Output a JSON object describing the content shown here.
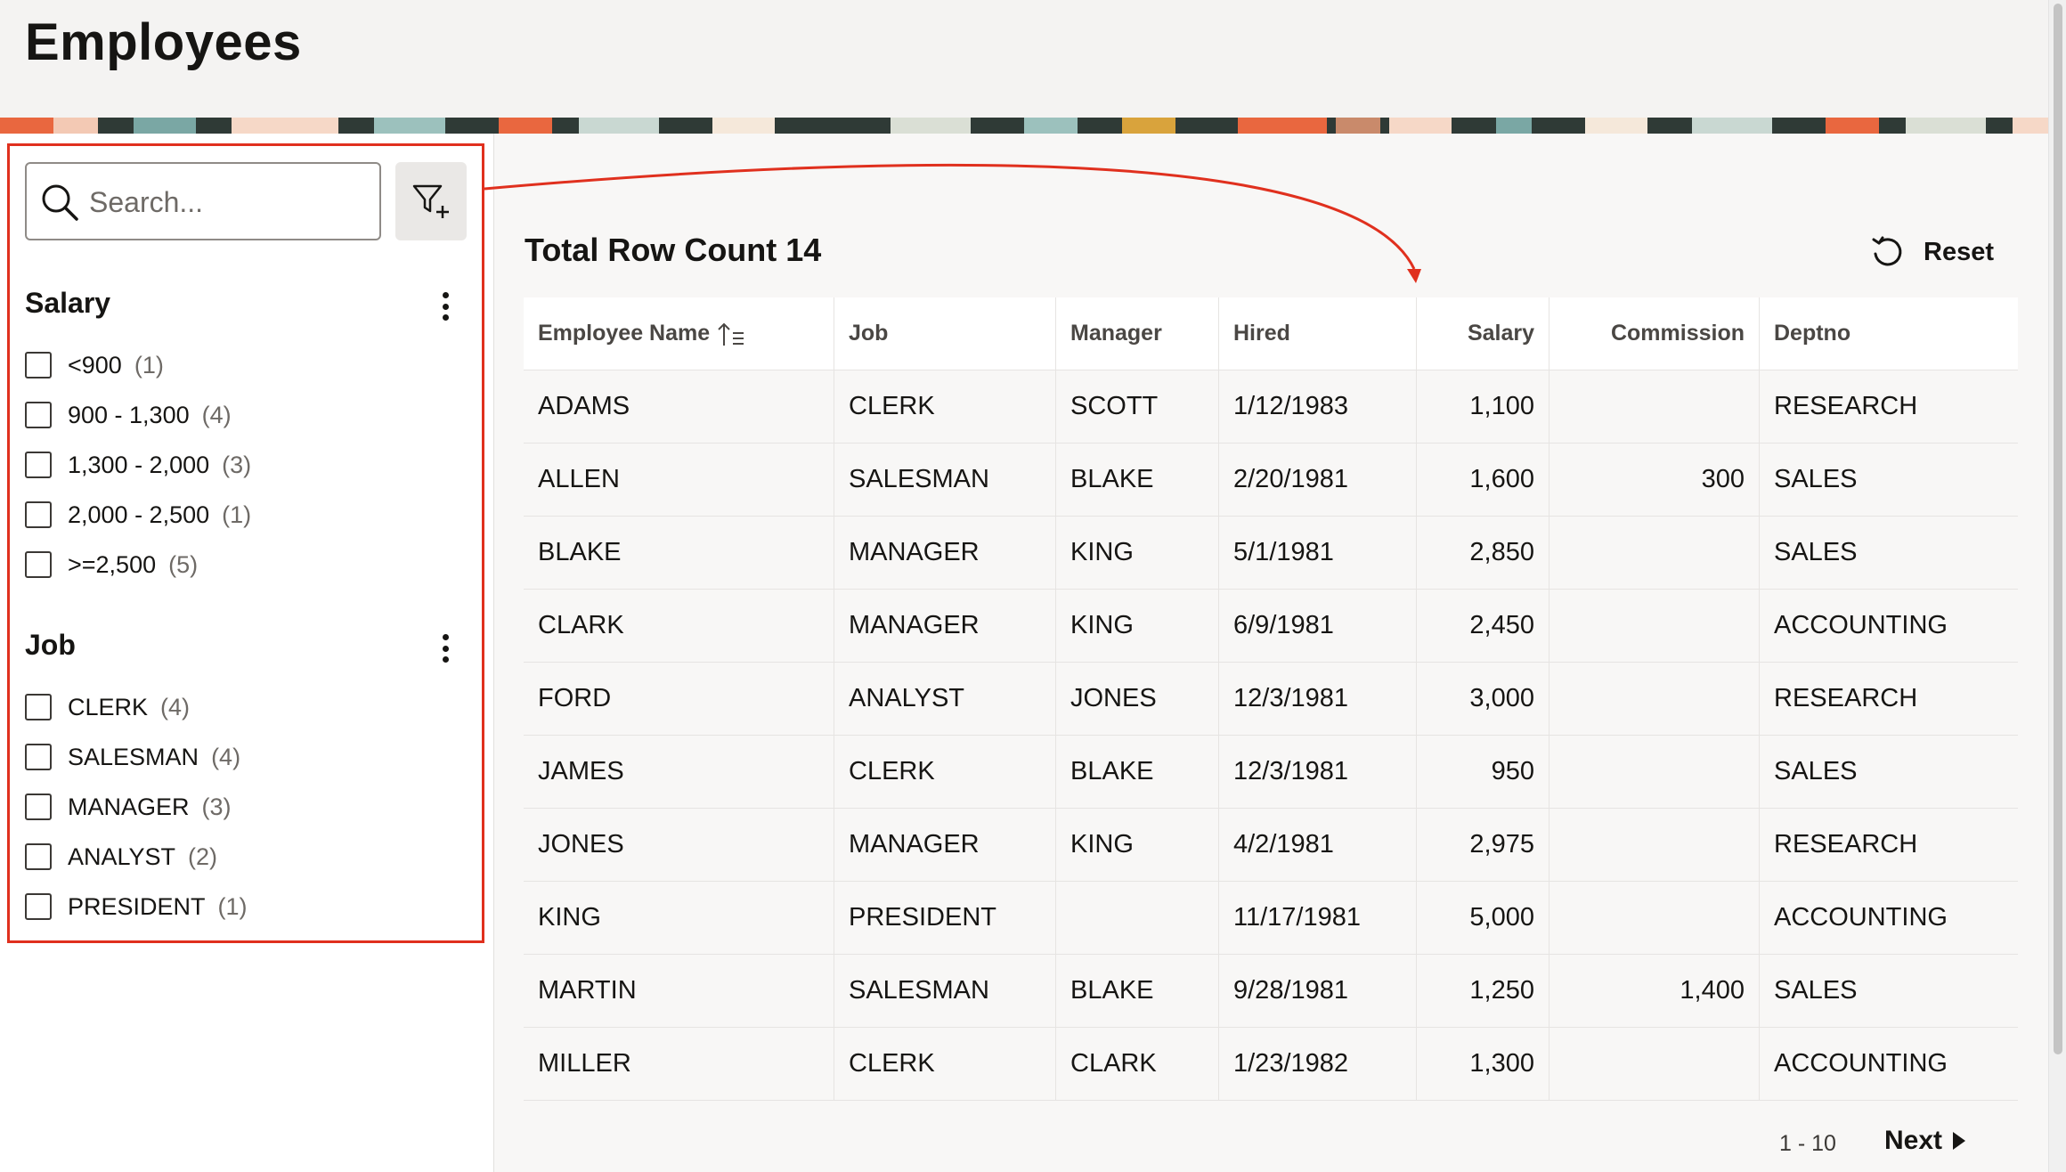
{
  "page": {
    "title": "Employees"
  },
  "search": {
    "placeholder": "Search..."
  },
  "facets": [
    {
      "title": "Salary",
      "items": [
        {
          "label": "<900",
          "count": "(1)"
        },
        {
          "label": "900 - 1,300",
          "count": "(4)"
        },
        {
          "label": "1,300 - 2,000",
          "count": "(3)"
        },
        {
          "label": "2,000 - 2,500",
          "count": "(1)"
        },
        {
          "label": ">=2,500",
          "count": "(5)"
        }
      ]
    },
    {
      "title": "Job",
      "items": [
        {
          "label": "CLERK",
          "count": "(4)"
        },
        {
          "label": "SALESMAN",
          "count": "(4)"
        },
        {
          "label": "MANAGER",
          "count": "(3)"
        },
        {
          "label": "ANALYST",
          "count": "(2)"
        },
        {
          "label": "PRESIDENT",
          "count": "(1)"
        }
      ]
    }
  ],
  "content": {
    "row_count": "Total Row Count 14",
    "reset_label": "Reset"
  },
  "table": {
    "columns": [
      "Employee Name",
      "Job",
      "Manager",
      "Hired",
      "Salary",
      "Commission",
      "Deptno"
    ],
    "rows": [
      [
        "ADAMS",
        "CLERK",
        "SCOTT",
        "1/12/1983",
        "1,100",
        "",
        "RESEARCH"
      ],
      [
        "ALLEN",
        "SALESMAN",
        "BLAKE",
        "2/20/1981",
        "1,600",
        "300",
        "SALES"
      ],
      [
        "BLAKE",
        "MANAGER",
        "KING",
        "5/1/1981",
        "2,850",
        "",
        "SALES"
      ],
      [
        "CLARK",
        "MANAGER",
        "KING",
        "6/9/1981",
        "2,450",
        "",
        "ACCOUNTING"
      ],
      [
        "FORD",
        "ANALYST",
        "JONES",
        "12/3/1981",
        "3,000",
        "",
        "RESEARCH"
      ],
      [
        "JAMES",
        "CLERK",
        "BLAKE",
        "12/3/1981",
        "950",
        "",
        "SALES"
      ],
      [
        "JONES",
        "MANAGER",
        "KING",
        "4/2/1981",
        "2,975",
        "",
        "RESEARCH"
      ],
      [
        "KING",
        "PRESIDENT",
        "",
        "11/17/1981",
        "5,000",
        "",
        "ACCOUNTING"
      ],
      [
        "MARTIN",
        "SALESMAN",
        "BLAKE",
        "9/28/1981",
        "1,250",
        "1,400",
        "SALES"
      ],
      [
        "MILLER",
        "CLERK",
        "CLARK",
        "1/23/1982",
        "1,300",
        "",
        "ACCOUNTING"
      ]
    ]
  },
  "pagination": {
    "range": "1 - 10",
    "next_label": "Next"
  },
  "colors": {
    "accent_red": "#e0301e",
    "text": "#161513",
    "muted": "#6e6a66"
  }
}
